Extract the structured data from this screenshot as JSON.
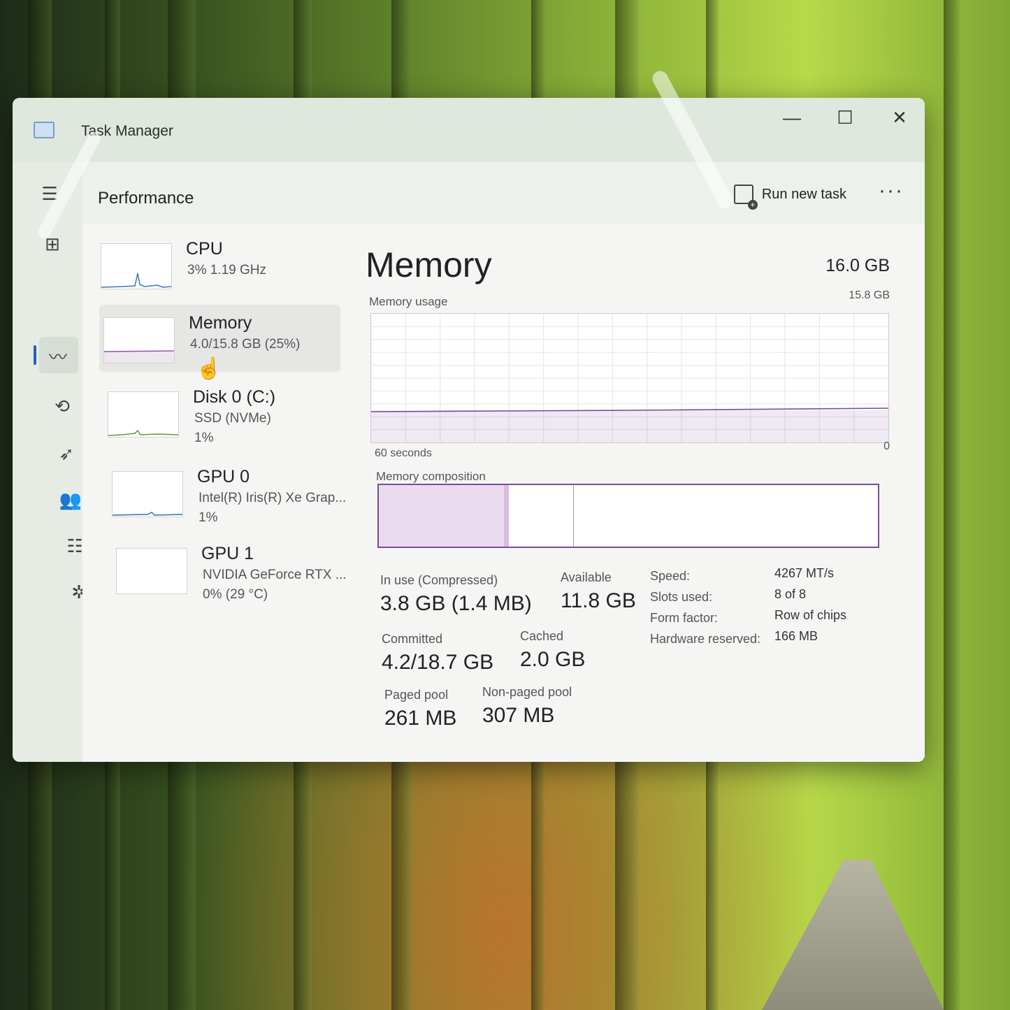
{
  "window": {
    "title": "Task Manager",
    "minimize": "—",
    "maximize": "☐",
    "close": "✕"
  },
  "header": {
    "title": "Performance",
    "run_new_task": "Run new task",
    "more": "···"
  },
  "nav": {
    "icons": [
      "hamburger-icon",
      "processes-icon",
      "performance-icon",
      "app-history-icon",
      "startup-apps-icon",
      "users-icon",
      "details-icon",
      "services-icon",
      "settings-icon"
    ]
  },
  "devices": [
    {
      "name": "CPU",
      "sub": "3%  1.19 GHz",
      "sub2": ""
    },
    {
      "name": "Memory",
      "sub": "4.0/15.8 GB (25%)",
      "sub2": ""
    },
    {
      "name": "Disk 0 (C:)",
      "sub": "SSD (NVMe)",
      "sub2": "1%"
    },
    {
      "name": "GPU 0",
      "sub": "Intel(R) Iris(R) Xe Grap...",
      "sub2": "1%"
    },
    {
      "name": "GPU 1",
      "sub": "NVIDIA GeForce RTX ...",
      "sub2": "0%  (29 °C)"
    }
  ],
  "memory": {
    "title": "Memory",
    "total": "16.0 GB",
    "usage_label": "Memory usage",
    "usage_max": "15.8 GB",
    "graph_x_label": "60 seconds",
    "graph_zero": "0",
    "usage_fraction": 0.25,
    "composition_label": "Memory composition",
    "composition": {
      "in_use_fraction": 0.25,
      "modified_fraction": 0.01,
      "standby_fraction": 0.13
    },
    "in_use_label": "In use (Compressed)",
    "in_use_value": "3.8 GB (1.4 MB)",
    "available_label": "Available",
    "available_value": "11.8 GB",
    "committed_label": "Committed",
    "committed_value": "4.2/18.7 GB",
    "cached_label": "Cached",
    "cached_value": "2.0 GB",
    "paged_label": "Paged pool",
    "paged_value": "261 MB",
    "nonpaged_label": "Non-paged pool",
    "nonpaged_value": "307 MB",
    "specs": [
      {
        "key": "Speed:",
        "value": "4267 MT/s"
      },
      {
        "key": "Slots used:",
        "value": "8 of 8"
      },
      {
        "key": "Form factor:",
        "value": "Row of chips"
      },
      {
        "key": "Hardware reserved:",
        "value": "166 MB"
      }
    ]
  },
  "colors": {
    "memory_accent": "#7a4c99",
    "nav_active": "#2a5ebd"
  }
}
